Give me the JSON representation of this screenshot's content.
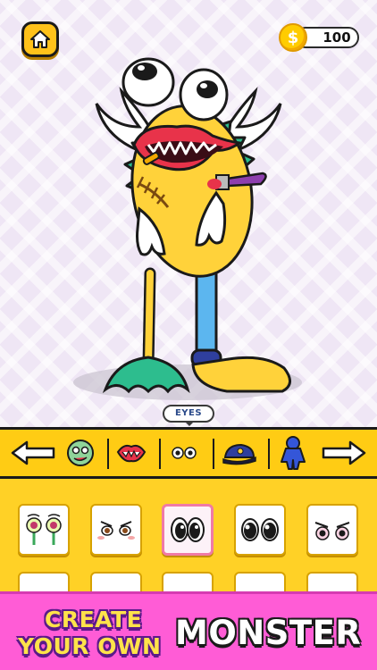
{
  "header": {
    "home_icon": "home-icon",
    "coin_icon": "dollar-coin-icon",
    "coins": "100"
  },
  "category_bar": {
    "current_label": "EYES",
    "prev_icon": "arrow-left-icon",
    "next_icon": "arrow-right-icon",
    "items": [
      {
        "icon": "zombie-face-icon"
      },
      {
        "icon": "mouth-icon"
      },
      {
        "icon": "eyes-icon"
      },
      {
        "icon": "hat-icon"
      },
      {
        "icon": "costume-icon"
      }
    ]
  },
  "options": {
    "selected_index": 2,
    "items": [
      {
        "icon": "green-bug-eyes-icon"
      },
      {
        "icon": "angry-blush-eyes-icon"
      },
      {
        "icon": "big-black-eyes-icon"
      },
      {
        "icon": "round-black-eyes-icon"
      },
      {
        "icon": "pink-angry-eyes-icon"
      },
      {
        "icon": "eyes-option-icon"
      },
      {
        "icon": "eyes-option-icon"
      },
      {
        "icon": "eyes-option-icon"
      },
      {
        "icon": "eyes-option-icon"
      },
      {
        "icon": "eyes-option-icon"
      }
    ]
  },
  "banner": {
    "line1": "CREATE",
    "line2": "YOUR OWN",
    "big": "MONSTER"
  },
  "colors": {
    "accent_yellow": "#ffcc14",
    "banner_pink": "#ff5cd6",
    "selected_border": "#f07aa6"
  }
}
